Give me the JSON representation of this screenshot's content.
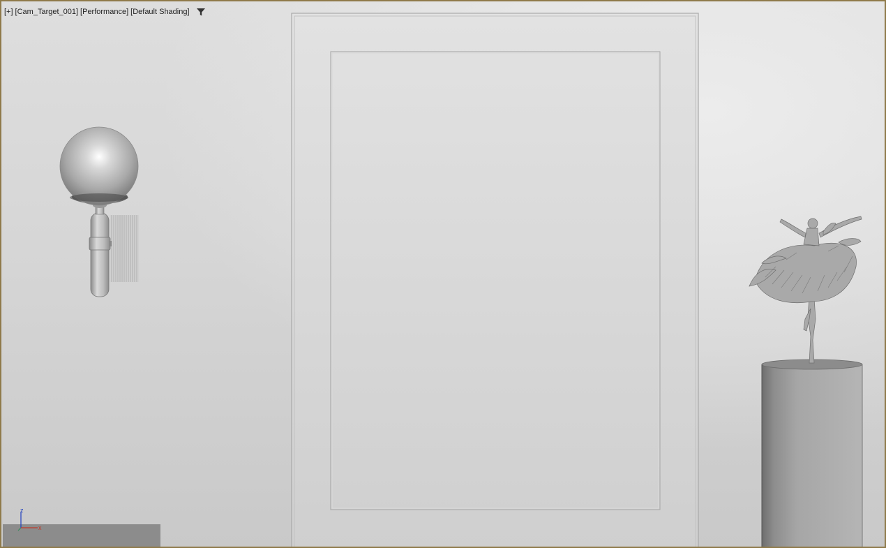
{
  "viewport": {
    "labels": {
      "plus": "[+]",
      "camera": "[Cam_Target_001]",
      "mode": "[Performance]",
      "shading": "[Default Shading]"
    },
    "filter_icon": "funnel-icon",
    "border_color": "#8f7a4a"
  },
  "gizmo": {
    "z_label": "z",
    "x_label": "x",
    "x_color": "#c0392b",
    "z_color": "#1f3fbf"
  },
  "scene": {
    "objects": [
      "wall-sconce-lamp",
      "door-panel",
      "ballerina-sculpture",
      "cylinder-pedestal"
    ]
  }
}
